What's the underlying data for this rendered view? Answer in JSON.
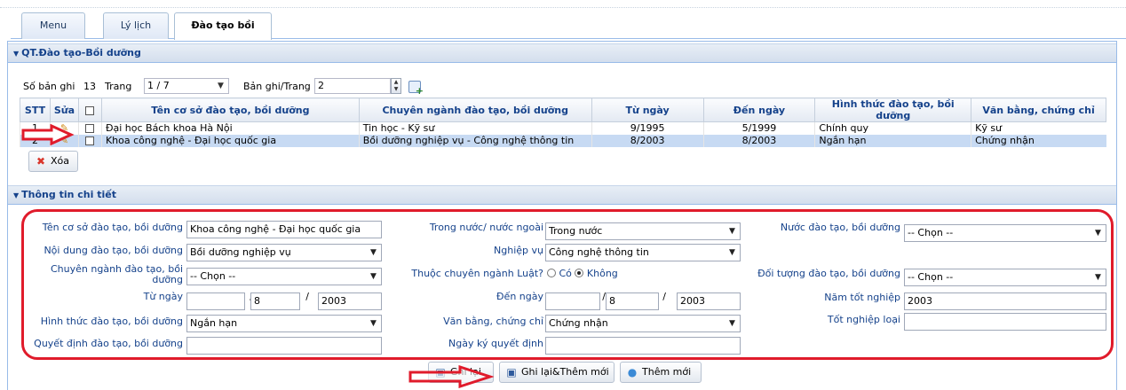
{
  "tabs": [
    {
      "label": "Menu",
      "active": false
    },
    {
      "label": "Lý lịch",
      "active": false
    },
    {
      "label": "Đào tạo bồi dưỡng",
      "active": true
    }
  ],
  "section1": {
    "title": "QT.Đào tạo-Bồi dưỡng",
    "record_count_label": "Số bản ghi",
    "record_count": "13",
    "page_label": "Trang",
    "page_value": "1 / 7",
    "per_page_label": "Bản ghi/Trang",
    "per_page_value": "2"
  },
  "grid": {
    "columns": [
      "STT",
      "Sửa",
      "",
      "Tên cơ sở đào tạo, bồi dưỡng",
      "Chuyên ngành đào tạo, bồi dưỡng",
      "Từ ngày",
      "Đến ngày",
      "Hình thức đào tạo, bồi dưỡng",
      "Văn bằng, chứng chỉ"
    ],
    "rows": [
      {
        "stt": "1",
        "ten": "Đại học Bách khoa Hà Nội",
        "chuyen_nganh": "Tin học - Kỹ sư",
        "tu_ngay": "9/1995",
        "den_ngay": "5/1999",
        "hinh_thuc": "Chính quy",
        "van_bang": "Kỹ sư",
        "selected": false
      },
      {
        "stt": "2",
        "ten": "Khoa công nghệ - Đại học quốc gia",
        "chuyen_nganh": "Bồi dưỡng nghiệp vụ - Công nghệ thông tin",
        "tu_ngay": "8/2003",
        "den_ngay": "8/2003",
        "hinh_thuc": "Ngắn hạn",
        "van_bang": "Chứng nhận",
        "selected": true
      }
    ]
  },
  "delete_button": "Xóa",
  "section2": {
    "title": "Thông tin chi tiết"
  },
  "form": {
    "ten_co_so_label": "Tên cơ sở đào tạo, bồi dưỡng",
    "ten_co_so_value": "Khoa công nghệ - Đại học quốc gia",
    "noi_dung_label": "Nội dung đào tạo, bồi dưỡng",
    "noi_dung_value": "Bồi dưỡng nghiệp vụ",
    "chuyen_nganh_label_1": "Chuyên ngành đào tạo, bồi",
    "chuyen_nganh_label_2": "dưỡng",
    "chuyen_nganh_value": "-- Chọn --",
    "tu_ngay_label": "Từ ngày",
    "tu_ngay_day": "",
    "tu_ngay_month": "8",
    "tu_ngay_year": "2003",
    "hinh_thuc_label": "Hình thức đào tạo, bồi dưỡng",
    "hinh_thuc_value": "Ngắn hạn",
    "quyet_dinh_label": "Quyết định đào tạo, bồi dưỡng",
    "quyet_dinh_value": "",
    "trong_nuoc_label": "Trong nước/ nước ngoài",
    "trong_nuoc_value": "Trong nước",
    "nghiep_vu_label": "Nghiệp vụ",
    "nghiep_vu_value": "Công nghệ thông tin",
    "luat_label": "Thuộc chuyên ngành Luật?",
    "luat_co": "Có",
    "luat_khong": "Không",
    "den_ngay_label": "Đến ngày",
    "den_ngay_day": "",
    "den_ngay_month": "8",
    "den_ngay_year": "2003",
    "van_bang_label": "Văn bằng, chứng chỉ",
    "van_bang_value": "Chứng nhận",
    "ngay_ky_label": "Ngày ký quyết định",
    "ngay_ky_value": "",
    "nuoc_dao_tao_label": "Nước đào tạo, bồi dưỡng",
    "nuoc_dao_tao_value": "-- Chọn --",
    "doi_tuong_label": "Đối tượng đào tạo, bồi dưỡng",
    "doi_tuong_value": "-- Chọn --",
    "nam_tot_nghiep_label": "Năm tốt nghiệp",
    "nam_tot_nghiep_value": "2003",
    "tot_nghiep_loai_label": "Tốt nghiệp loại",
    "tot_nghiep_loai_value": ""
  },
  "buttons": {
    "save": "Ghi lại",
    "save_new": "Ghi lại&Thêm mới",
    "new": "Thêm mới"
  },
  "colors": {
    "annotation_red": "#e01b2b",
    "header_blue": "#15428b",
    "selected_row": "#c7daf3"
  }
}
